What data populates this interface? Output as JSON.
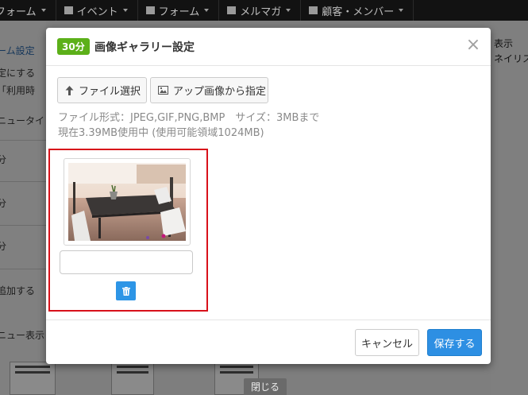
{
  "background": {
    "topnav": [
      {
        "label": "フォーム",
        "icon": "none"
      },
      {
        "label": "イベント",
        "icon": "flag-icon"
      },
      {
        "label": "フォーム",
        "icon": "form-icon"
      },
      {
        "label": "メルマガ",
        "icon": "mail-icon"
      },
      {
        "label": "顧客・メンバー",
        "icon": "users-icon"
      }
    ],
    "left_texts": [
      "ーム設定",
      "定にする",
      "「利用時",
      "ニュータイ",
      "分",
      "分",
      "分",
      "追加する",
      "ニュー表示"
    ],
    "right_texts": [
      "表示",
      "ネイリス"
    ],
    "close_tab": "閉じる"
  },
  "modal": {
    "badge": "30分",
    "title": "画像ギャラリー設定",
    "close_glyph": "×",
    "buttons": {
      "file_select": "ファイル選択",
      "from_uploaded": "アップ画像から指定"
    },
    "info": {
      "formats": "ファイル形式：JPEG,GIF,PNG,BMP　サイズ：3MBまで",
      "usage": "現在3.39MB使用中 (使用可能領域1024MB)"
    },
    "caption_value": "",
    "footer": {
      "cancel": "キャンセル",
      "save": "保存する"
    }
  },
  "colors": {
    "badge": "#5cb019",
    "primary": "#2d8fe3",
    "highlight": "#d8111a"
  }
}
